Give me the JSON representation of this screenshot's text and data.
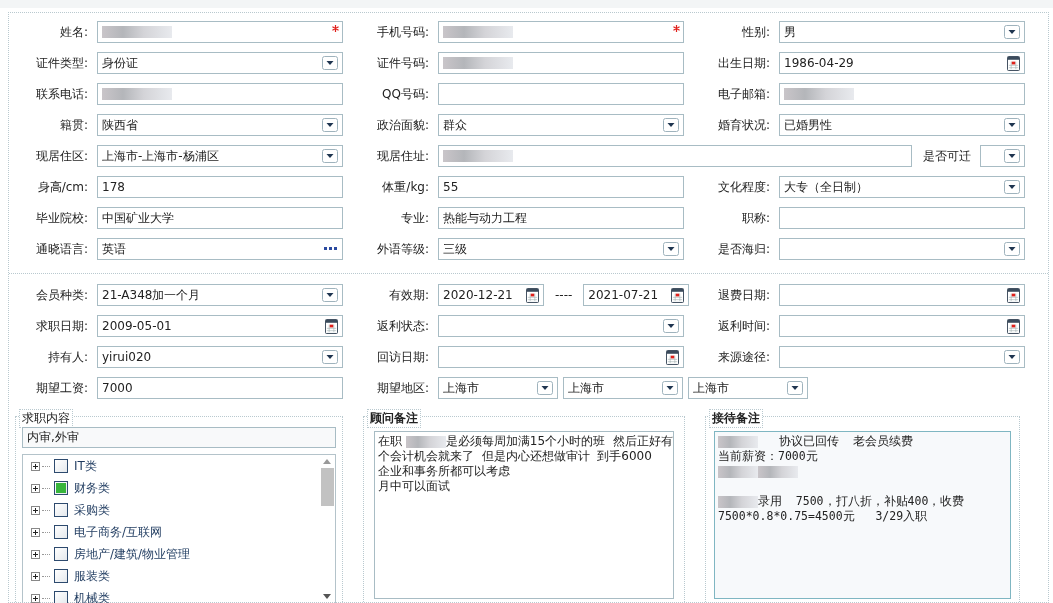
{
  "personal": {
    "rows": [
      [
        {
          "label": "姓名:",
          "fields": [
            {
              "kind": "text",
              "redacted": true,
              "required": true
            }
          ]
        },
        {
          "label": "手机号码:",
          "fields": [
            {
              "kind": "text",
              "redacted": true,
              "required": true
            }
          ]
        },
        {
          "label": "性别:",
          "fields": [
            {
              "kind": "select",
              "value": "男"
            }
          ]
        }
      ],
      [
        {
          "label": "证件类型:",
          "fields": [
            {
              "kind": "select",
              "value": "身份证"
            }
          ]
        },
        {
          "label": "证件号码:",
          "fields": [
            {
              "kind": "text",
              "redacted": true
            }
          ]
        },
        {
          "label": "出生日期:",
          "fields": [
            {
              "kind": "date",
              "value": "1986-04-29"
            }
          ]
        }
      ],
      [
        {
          "label": "联系电话:",
          "fields": [
            {
              "kind": "text",
              "redacted": true
            }
          ]
        },
        {
          "label": "QQ号码:",
          "fields": [
            {
              "kind": "text"
            }
          ]
        },
        {
          "label": "电子邮箱:",
          "fields": [
            {
              "kind": "text",
              "redacted": true
            }
          ]
        }
      ],
      [
        {
          "label": "籍贯:",
          "fields": [
            {
              "kind": "select",
              "value": "陕西省"
            }
          ]
        },
        {
          "label": "政治面貌:",
          "fields": [
            {
              "kind": "select",
              "value": "群众"
            }
          ]
        },
        {
          "label": "婚育状况:",
          "fields": [
            {
              "kind": "select",
              "value": "已婚男性"
            }
          ]
        }
      ],
      [
        {
          "label": "现居住区:",
          "fields": [
            {
              "kind": "select",
              "value": " 上海市-上海市-杨浦区"
            }
          ]
        },
        {
          "label": "现居住址:",
          "fields": [
            {
              "kind": "text",
              "redacted": true
            },
            {
              "kind": "label",
              "value": "是否可迁"
            },
            {
              "kind": "select"
            }
          ]
        }
      ],
      [
        {
          "label": "身高/cm:",
          "fields": [
            {
              "kind": "text",
              "value": "178"
            }
          ]
        },
        {
          "label": "体重/kg:",
          "fields": [
            {
              "kind": "text",
              "value": "55"
            }
          ]
        },
        {
          "label": "文化程度:",
          "fields": [
            {
              "kind": "select",
              "value": "大专（全日制）"
            }
          ]
        }
      ],
      [
        {
          "label": "毕业院校:",
          "fields": [
            {
              "kind": "text",
              "value": "中国矿业大学"
            }
          ]
        },
        {
          "label": "专业:",
          "fields": [
            {
              "kind": "text",
              "value": "热能与动力工程"
            }
          ]
        },
        {
          "label": "职称:",
          "fields": [
            {
              "kind": "text"
            }
          ]
        }
      ],
      [
        {
          "label": "通晓语言:",
          "fields": [
            {
              "kind": "lookup",
              "value": "英语"
            }
          ]
        },
        {
          "label": "外语等级:",
          "fields": [
            {
              "kind": "select",
              "value": "三级"
            }
          ]
        },
        {
          "label": "是否海归:",
          "fields": [
            {
              "kind": "select"
            }
          ]
        }
      ]
    ]
  },
  "membership": {
    "rows": [
      [
        {
          "label": "会员种类:",
          "fields": [
            {
              "kind": "select",
              "value": " 21-A348加一个月"
            }
          ]
        },
        {
          "label": "有效期:",
          "fields": [
            {
              "kind": "date",
              "value": "2020-12-21"
            },
            {
              "kind": "sep",
              "value": "----"
            },
            {
              "kind": "date",
              "value": "2021-07-21"
            }
          ]
        },
        {
          "label": "退费日期:",
          "fields": [
            {
              "kind": "date"
            }
          ]
        }
      ],
      [
        {
          "label": "求职日期:",
          "fields": [
            {
              "kind": "date",
              "value": "2009-05-01"
            }
          ]
        },
        {
          "label": "返利状态:",
          "fields": [
            {
              "kind": "select"
            }
          ]
        },
        {
          "label": "返利时间:",
          "fields": [
            {
              "kind": "date"
            }
          ]
        }
      ],
      [
        {
          "label": "持有人:",
          "fields": [
            {
              "kind": "select",
              "value": "yirui020"
            }
          ]
        },
        {
          "label": "回访日期:",
          "fields": [
            {
              "kind": "date"
            }
          ]
        },
        {
          "label": "来源途径:",
          "fields": [
            {
              "kind": "select"
            }
          ]
        }
      ],
      [
        {
          "label": "期望工资:",
          "fields": [
            {
              "kind": "text",
              "value": "7000"
            }
          ]
        },
        {
          "label": "期望地区:",
          "fields": [
            {
              "kind": "select",
              "value": "上海市"
            },
            {
              "kind": "select",
              "value": "上海市"
            },
            {
              "kind": "select",
              "value": "上海市"
            }
          ]
        }
      ]
    ]
  },
  "job_content": {
    "title": "求职内容",
    "value": "内审,外审",
    "tree": [
      {
        "label": "IT类",
        "checked": false
      },
      {
        "label": "财务类",
        "checked": true
      },
      {
        "label": "采购类",
        "checked": false
      },
      {
        "label": "电子商务/互联网",
        "checked": false
      },
      {
        "label": "房地产/建筑/物业管理",
        "checked": false
      },
      {
        "label": "服装类",
        "checked": false
      },
      {
        "label": "机械类",
        "checked": false
      }
    ]
  },
  "advisor_notes": {
    "title": "顾问备注",
    "lines": [
      {
        "segments": [
          {
            "text": "在职 "
          },
          {
            "kind": "redacted"
          },
          {
            "text": "是必须每周加满15个小时的班  然后正好有"
          }
        ]
      },
      {
        "segments": [
          {
            "text": "个会计机会就来了  但是内心还想做审计  到手6000"
          }
        ]
      },
      {
        "segments": [
          {
            "text": "企业和事务所都可以考虑"
          }
        ]
      },
      {
        "segments": [
          {
            "text": "月中可以面试"
          }
        ]
      }
    ]
  },
  "reception_notes": {
    "title": "接待备注",
    "lines": [
      {
        "segments": [
          {
            "kind": "redacted"
          },
          {
            "text": "   协议已回传  老会员续费"
          }
        ]
      },
      {
        "segments": [
          {
            "text": "当前薪资：7000元"
          }
        ]
      },
      {
        "segments": [
          {
            "kind": "redacted"
          },
          {
            "kind": "redacted"
          }
        ]
      },
      {
        "kind": "blank"
      },
      {
        "segments": [
          {
            "kind": "redacted"
          },
          {
            "text": "录用  7500，打八折，补贴400，收费"
          }
        ]
      },
      {
        "segments": [
          {
            "text": "7500*0.8*0.75=4500元   3/29入职"
          }
        ]
      }
    ]
  }
}
